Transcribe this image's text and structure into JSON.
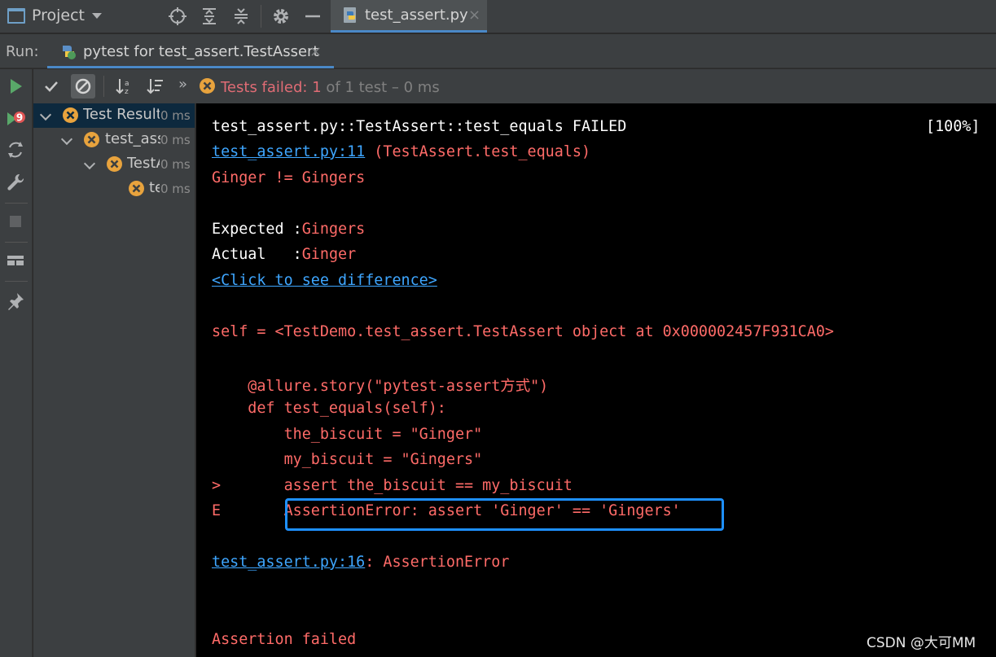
{
  "topbar": {
    "project_label": "Project",
    "editor_tab": {
      "label": "test_assert.py",
      "close": "×"
    }
  },
  "runbar": {
    "run_label": "Run:",
    "tab_label": "pytest for test_assert.TestAssert",
    "tab_close": "×"
  },
  "testbar": {
    "status_failed": "Tests failed: 1",
    "status_rest": " of 1 test – 0 ms",
    "more": "»"
  },
  "tree": {
    "rows": [
      {
        "name": "Test Results",
        "time": "0 ms"
      },
      {
        "name": "test_assert",
        "time": "0 ms"
      },
      {
        "name": "TestAssert",
        "time": "0 ms"
      },
      {
        "name": "test_equals",
        "time": "0 ms"
      }
    ]
  },
  "console": {
    "l1": "test_assert.py::TestAssert::test_equals FAILED",
    "l1_pct": "[100%]",
    "l2_link": "test_assert.py:11",
    "l2_rest": " (TestAssert.test_equals)",
    "l3": "Ginger != Gingers",
    "l4_a": "Expected :",
    "l4_b": "Gingers",
    "l5_a": "Actual   :",
    "l5_b": "Ginger",
    "l6_link": "<Click to see difference>",
    "l7": "self = <TestDemo.test_assert.TestAssert object at 0x000002457F931CA0>",
    "l8": "    @allure.story(\"pytest-assert方式\")",
    "l9": "    def test_equals(self):",
    "l10": "        the_biscuit = \"Ginger\"",
    "l11": "        my_biscuit = \"Gingers\"",
    "l12": ">       assert the_biscuit == my_biscuit",
    "l13": "E       AssertionError: assert 'Ginger' == 'Gingers'",
    "l14_link": "test_assert.py:16",
    "l14_rest": ": AssertionError",
    "l15": "Assertion failed"
  },
  "watermark": "CSDN @大可MM",
  "colors": {
    "bg": "#2b2b2b",
    "panel": "#3c3f41",
    "console_bg": "#000000",
    "error_red": "#ff6b68",
    "link_blue": "#3ea6ff",
    "accent_blue": "#4a88c7",
    "fail_orange": "#e8a33d",
    "run_green": "#59a869"
  }
}
